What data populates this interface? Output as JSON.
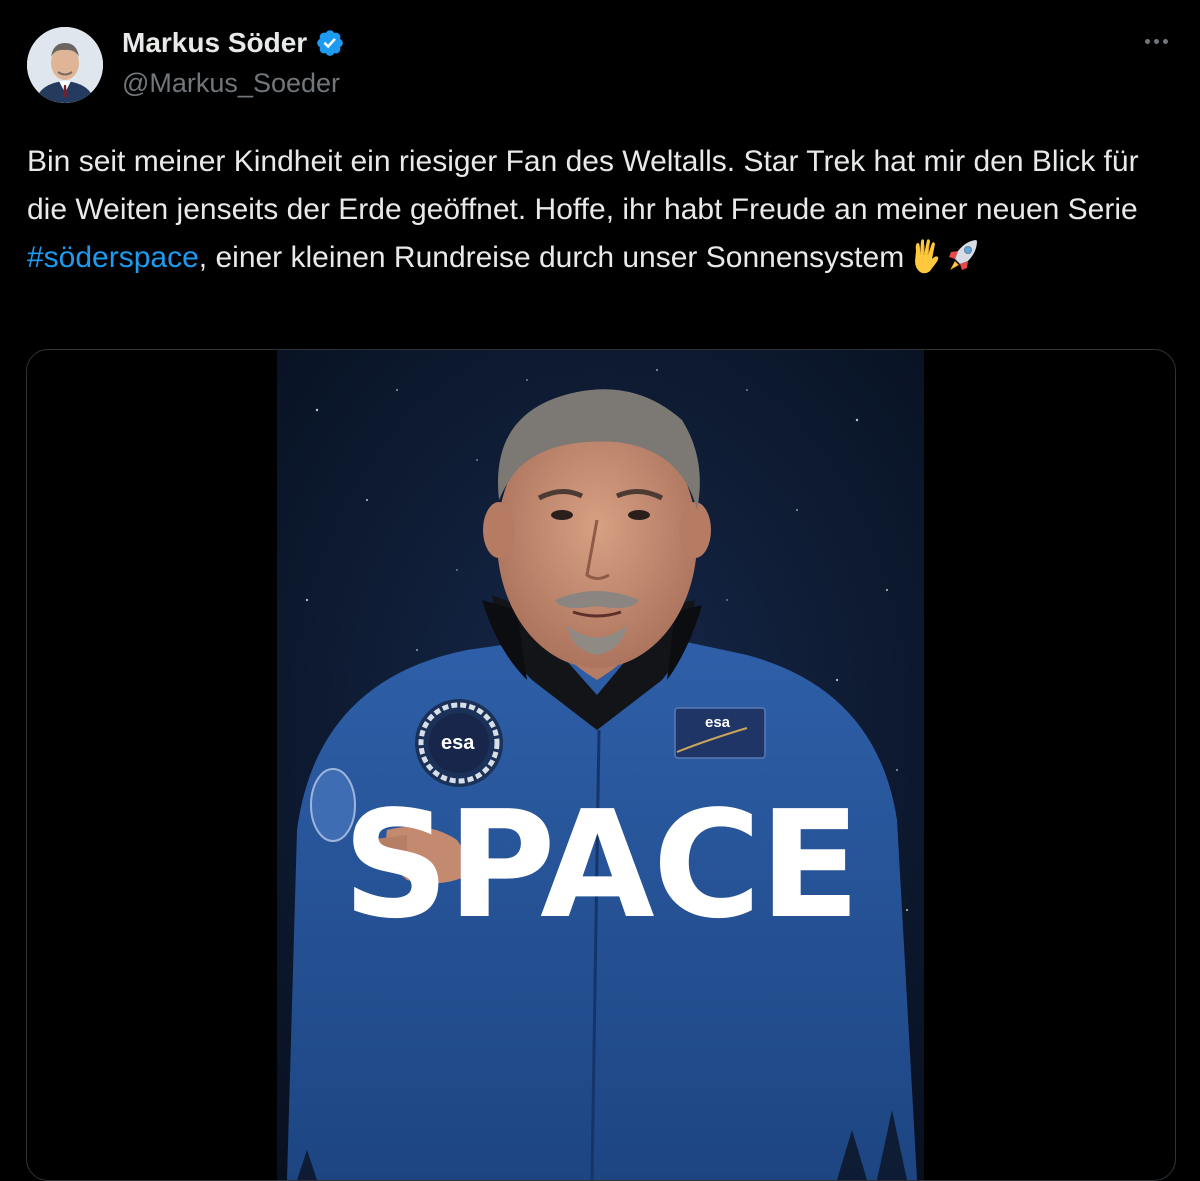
{
  "user": {
    "display_name": "Markus Söder",
    "handle": "@Markus_Soeder",
    "verified": true
  },
  "icons": {
    "verified": "verified-badge-icon",
    "more": "more-options-icon",
    "emoji_1": "vulcan-salute-emoji",
    "emoji_2": "rocket-emoji"
  },
  "tweet": {
    "text_before_hashtag": "Bin seit meiner Kindheit ein riesiger Fan des Weltalls. Star Trek hat mir den Blick für die Weiten jenseits der Erde geöffnet. Hoffe, ihr habt Freude an meiner neuen Serie ",
    "hashtag": "#söderspace",
    "text_after_hashtag": ", einer kleinen Rundreise durch unser Sonnensystem"
  },
  "media": {
    "overlay_word": "SPACE",
    "patch_text": "esa",
    "name_tag_logo": "esa"
  },
  "colors": {
    "background": "#000000",
    "text": "#e7e9ea",
    "secondary_text": "#71767b",
    "link": "#1d9bf0",
    "verified": "#1d9bf0",
    "border": "#2f3336"
  }
}
